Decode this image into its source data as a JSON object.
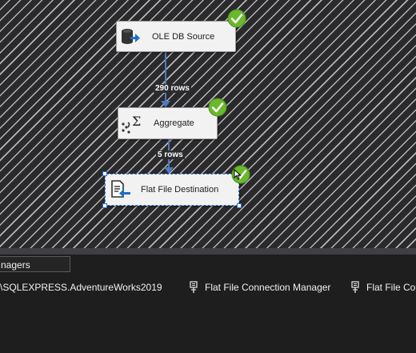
{
  "dataflow": {
    "tasks": [
      {
        "label": "OLE DB Source",
        "icon": "ole-db-source-icon",
        "status": "success"
      },
      {
        "label": "Aggregate",
        "icon": "aggregate-icon",
        "status": "success"
      },
      {
        "label": "Flat File Destination",
        "icon": "flat-file-destination-icon",
        "status": "success",
        "selected": true
      }
    ],
    "paths": [
      {
        "row_count": "290 rows"
      },
      {
        "row_count": "5 rows"
      }
    ]
  },
  "connection_managers": {
    "tab_label": "nagers",
    "items": [
      {
        "label": "\\SQLEXPRESS.AdventureWorks2019",
        "icon": "ole-db-connection-icon"
      },
      {
        "label": "Flat File Connection Manager",
        "icon": "flat-file-connection-icon"
      },
      {
        "label": "Flat File Co",
        "icon": "flat-file-connection-icon"
      }
    ]
  },
  "colors": {
    "canvas_background": "#2d2d30",
    "task_background": "#f2f2f2",
    "success_green": "#6ab82c",
    "path_arrow": "#4a7cbf",
    "selection_blue": "#2a6fd6"
  }
}
